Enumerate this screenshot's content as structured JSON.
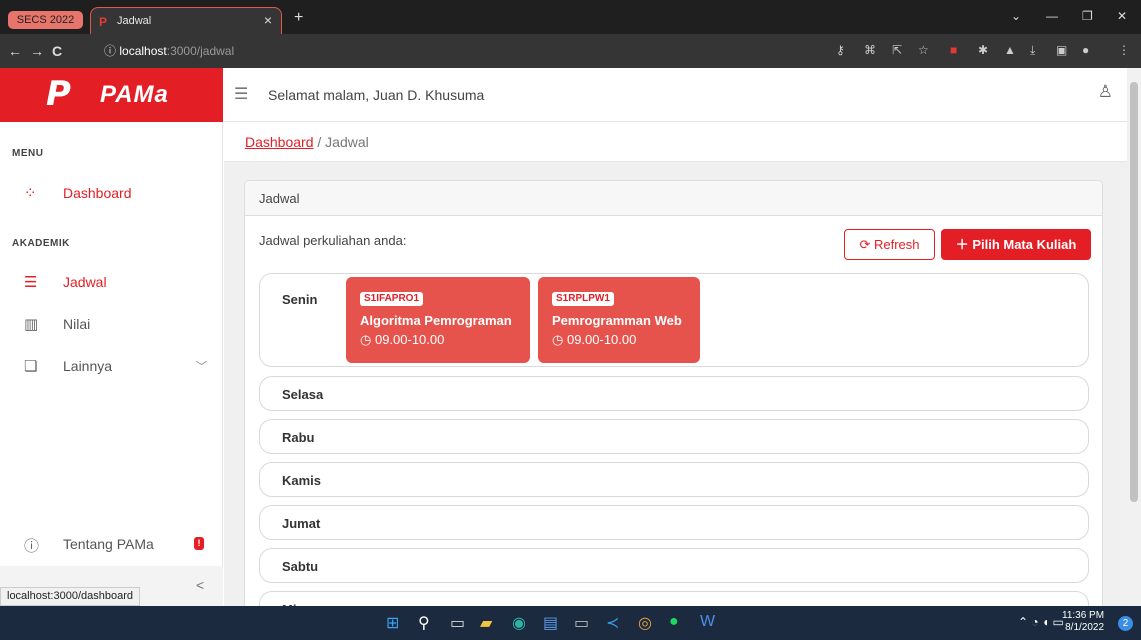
{
  "browser": {
    "tab_group": "SECS 2022",
    "tab_favicon": "P",
    "tab_title": "Jadwal",
    "tab_close": "×",
    "new_tab": "+",
    "url_host": "localhost",
    "url_path": ":3000/jadwal",
    "status_url": "localhost:3000/dashboard",
    "back": "←",
    "forward": "→",
    "reload": "C",
    "info": "ⓘ"
  },
  "app": {
    "logo_glyph": "P",
    "name": "PAMa",
    "greeting": "Selamat malam, Juan D. Khusuma"
  },
  "sidebar": {
    "section_menu": "MENU",
    "section_akademik": "AKADEMIK",
    "items": [
      {
        "label": "Dashboard",
        "icon": "grid-icon"
      },
      {
        "label": "Jadwal",
        "icon": "list-icon"
      },
      {
        "label": "Nilai",
        "icon": "chart-icon"
      },
      {
        "label": "Lainnya",
        "icon": "copy-icon"
      },
      {
        "label": "Tentang PAMa",
        "icon": "info-icon"
      }
    ],
    "badge": "!",
    "collapse": "<"
  },
  "breadcrumb": {
    "root": "Dashboard",
    "sep": "/",
    "current": "Jadwal"
  },
  "card": {
    "title": "Jadwal",
    "subtitle": "Jadwal perkuliahan anda:",
    "refresh_label": "Refresh",
    "add_label": "Pilih Mata Kuliah"
  },
  "schedule": [
    {
      "day": "Senin",
      "courses": [
        {
          "code": "S1IFAPRO1",
          "name": "Algoritma Pemrograman",
          "time": "09.00-10.00"
        },
        {
          "code": "S1RPLPW1",
          "name": "Pemrogramman Web",
          "time": "09.00-10.00"
        }
      ]
    },
    {
      "day": "Selasa",
      "courses": []
    },
    {
      "day": "Rabu",
      "courses": []
    },
    {
      "day": "Kamis",
      "courses": []
    },
    {
      "day": "Jumat",
      "courses": []
    },
    {
      "day": "Sabtu",
      "courses": []
    },
    {
      "day": "Minggu",
      "courses": []
    }
  ],
  "taskbar": {
    "time": "11:36 PM",
    "date": "8/1/2022",
    "notif_count": "2"
  },
  "colors": {
    "brand": "#e31e24",
    "course_card": "#e5534c"
  }
}
